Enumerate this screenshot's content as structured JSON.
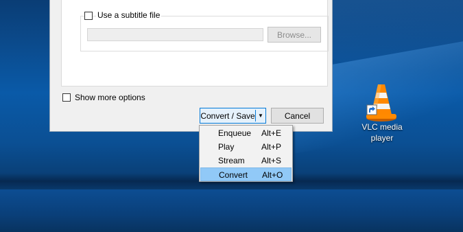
{
  "dialog": {
    "subtitle_checkbox_label": "Use a subtitle file",
    "browse_label": "Browse...",
    "show_more_label": "Show more options",
    "convert_save_label": "Convert / Save",
    "cancel_label": "Cancel"
  },
  "dropdown_menu": {
    "items": [
      {
        "label": "Enqueue",
        "shortcut": "Alt+E"
      },
      {
        "label": "Play",
        "shortcut": "Alt+P"
      },
      {
        "label": "Stream",
        "shortcut": "Alt+S"
      },
      {
        "label": "Convert",
        "shortcut": "Alt+O"
      }
    ],
    "highlighted": "Convert"
  },
  "desktop": {
    "shortcut_icon": "vlc-cone-icon",
    "shortcut_label_line1": "VLC media",
    "shortcut_label_line2": "player"
  },
  "colors": {
    "accent": "#0078d7",
    "menu_highlight": "#91c9f7",
    "vlc_orange": "#ff8800"
  }
}
